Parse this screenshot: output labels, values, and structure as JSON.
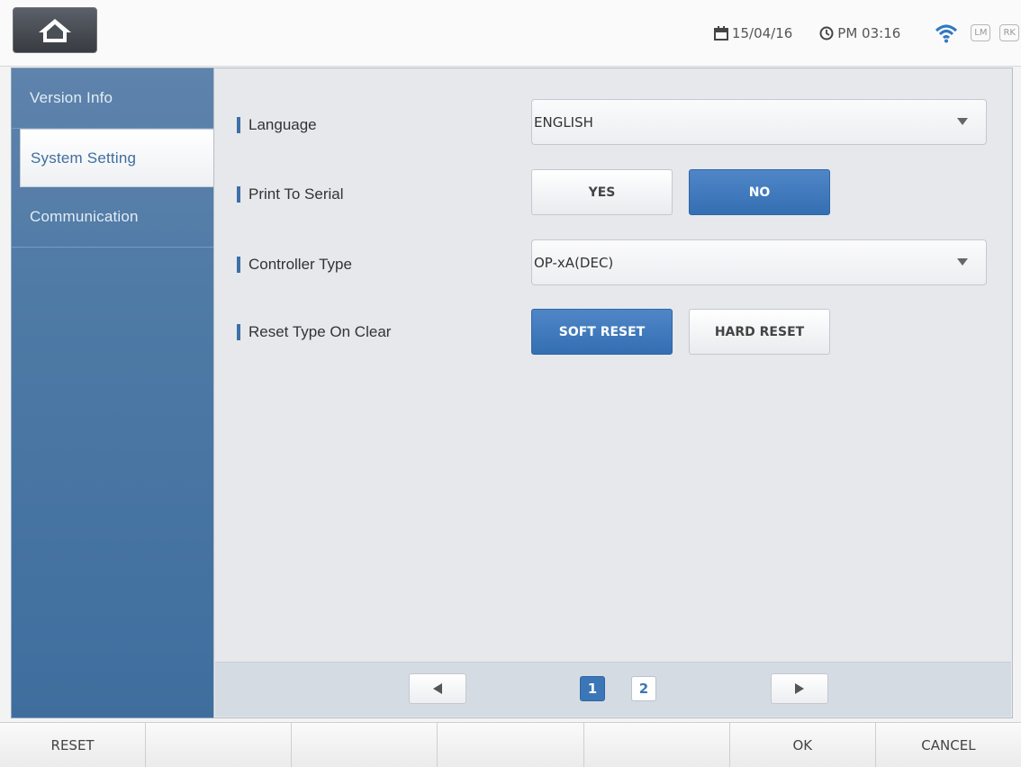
{
  "status": {
    "date": "15/04/16",
    "time": "PM 03:16",
    "chips": [
      "LM",
      "RK"
    ]
  },
  "sidebar": {
    "items": [
      {
        "label": "Version Info"
      },
      {
        "label": "System Setting"
      },
      {
        "label": "Communication"
      }
    ]
  },
  "settings": {
    "language": {
      "label": "Language",
      "value": "ENGLISH"
    },
    "print_to_serial": {
      "label": "Print To Serial",
      "yes": "YES",
      "no": "NO",
      "selected": "NO"
    },
    "controller_type": {
      "label": "Controller Type",
      "value": "OP-xA(DEC)"
    },
    "reset_type": {
      "label": "Reset Type On Clear",
      "soft": "SOFT RESET",
      "hard": "HARD RESET",
      "selected": "SOFT RESET"
    }
  },
  "pager": {
    "pages": [
      "1",
      "2"
    ],
    "current": "1"
  },
  "function_keys": [
    "RESET",
    "",
    "",
    "",
    "",
    "OK",
    "CANCEL"
  ],
  "colors": {
    "accent": "#3b76b7",
    "sidebar": "#4d79a5"
  },
  "icons": {
    "home": "home-icon",
    "date": "calendar-icon",
    "time": "clock-icon",
    "wifi": "wifi-icon",
    "prev": "triangle-left-icon",
    "next": "triangle-right-icon"
  }
}
